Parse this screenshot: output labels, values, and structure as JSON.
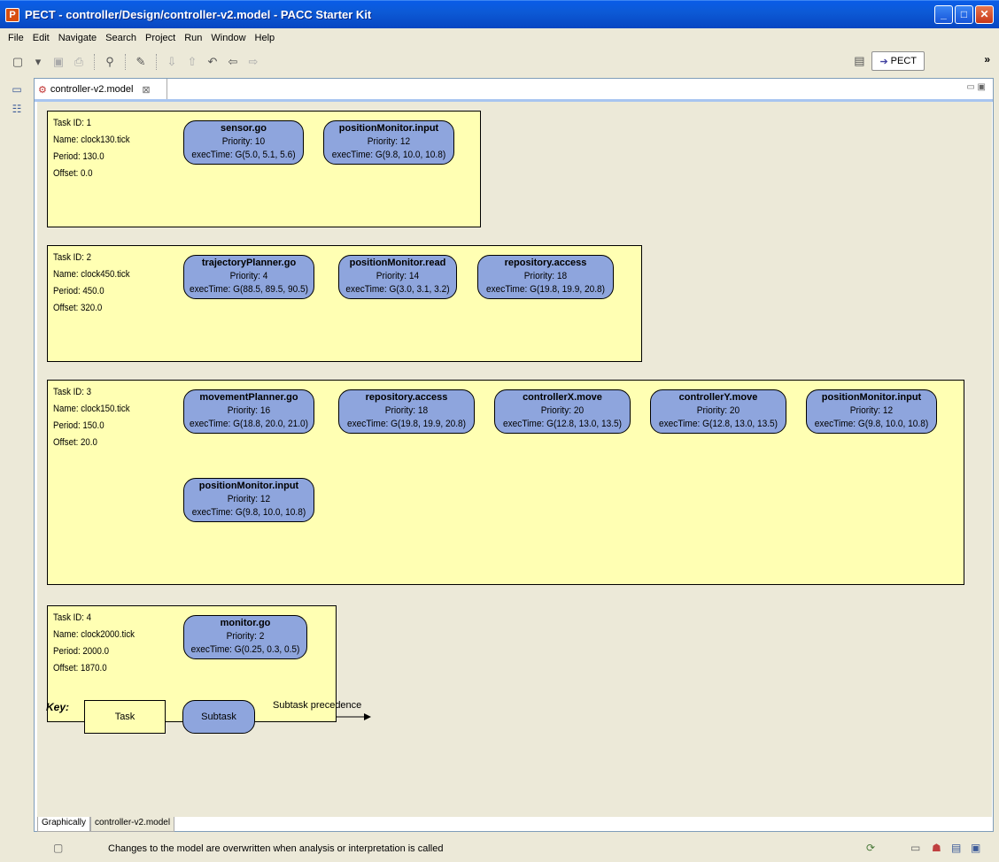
{
  "window": {
    "title": "PECT - controller/Design/controller-v2.model - PACC Starter Kit",
    "app_icon": "P"
  },
  "menu": [
    "File",
    "Edit",
    "Navigate",
    "Search",
    "Project",
    "Run",
    "Window",
    "Help"
  ],
  "perspective": {
    "label": "PECT"
  },
  "editor": {
    "tab_label": "controller-v2.model"
  },
  "tasks": [
    {
      "id": "Task ID: 1",
      "name": "Name: clock130.tick",
      "period": "Period: 130.0",
      "offset": "Offset: 0.0",
      "subtasks": [
        {
          "name": "sensor.go",
          "priority": "Priority: 10",
          "exec": "execTime: G(5.0, 5.1, 5.6)"
        },
        {
          "name": "positionMonitor.input",
          "priority": "Priority: 12",
          "exec": "execTime: G(9.8, 10.0, 10.8)"
        }
      ]
    },
    {
      "id": "Task ID: 2",
      "name": "Name: clock450.tick",
      "period": "Period: 450.0",
      "offset": "Offset: 320.0",
      "subtasks": [
        {
          "name": "trajectoryPlanner.go",
          "priority": "Priority: 4",
          "exec": "execTime: G(88.5, 89.5, 90.5)"
        },
        {
          "name": "positionMonitor.read",
          "priority": "Priority: 14",
          "exec": "execTime: G(3.0, 3.1, 3.2)"
        },
        {
          "name": "repository.access",
          "priority": "Priority: 18",
          "exec": "execTime: G(19.8, 19.9, 20.8)"
        }
      ]
    },
    {
      "id": "Task ID: 3",
      "name": "Name: clock150.tick",
      "period": "Period: 150.0",
      "offset": "Offset: 20.0",
      "subtasks": [
        {
          "name": "movementPlanner.go",
          "priority": "Priority: 16",
          "exec": "execTime: G(18.8, 20.0, 21.0)"
        },
        {
          "name": "repository.access",
          "priority": "Priority: 18",
          "exec": "execTime: G(19.8, 19.9, 20.8)"
        },
        {
          "name": "controllerX.move",
          "priority": "Priority: 20",
          "exec": "execTime: G(12.8, 13.0, 13.5)"
        },
        {
          "name": "controllerY.move",
          "priority": "Priority: 20",
          "exec": "execTime: G(12.8, 13.0, 13.5)"
        },
        {
          "name": "positionMonitor.input",
          "priority": "Priority: 12",
          "exec": "execTime: G(9.8, 10.0, 10.8)"
        },
        {
          "name": "positionMonitor.input",
          "priority": "Priority: 12",
          "exec": "execTime: G(9.8, 10.0, 10.8)"
        }
      ]
    },
    {
      "id": "Task ID: 4",
      "name": "Name: clock2000.tick",
      "period": "Period: 2000.0",
      "offset": "Offset: 1870.0",
      "subtasks": [
        {
          "name": "monitor.go",
          "priority": "Priority: 2",
          "exec": "execTime: G(0.25, 0.3, 0.5)"
        }
      ]
    }
  ],
  "key": {
    "label": "Key:",
    "task": "Task",
    "subtask": "Subtask",
    "precedence": "Subtask precedence"
  },
  "bottom_tabs": [
    "Graphically",
    "controller-v2.model"
  ],
  "status": {
    "message": "Changes to the model are overwritten when analysis or interpretation is called"
  }
}
